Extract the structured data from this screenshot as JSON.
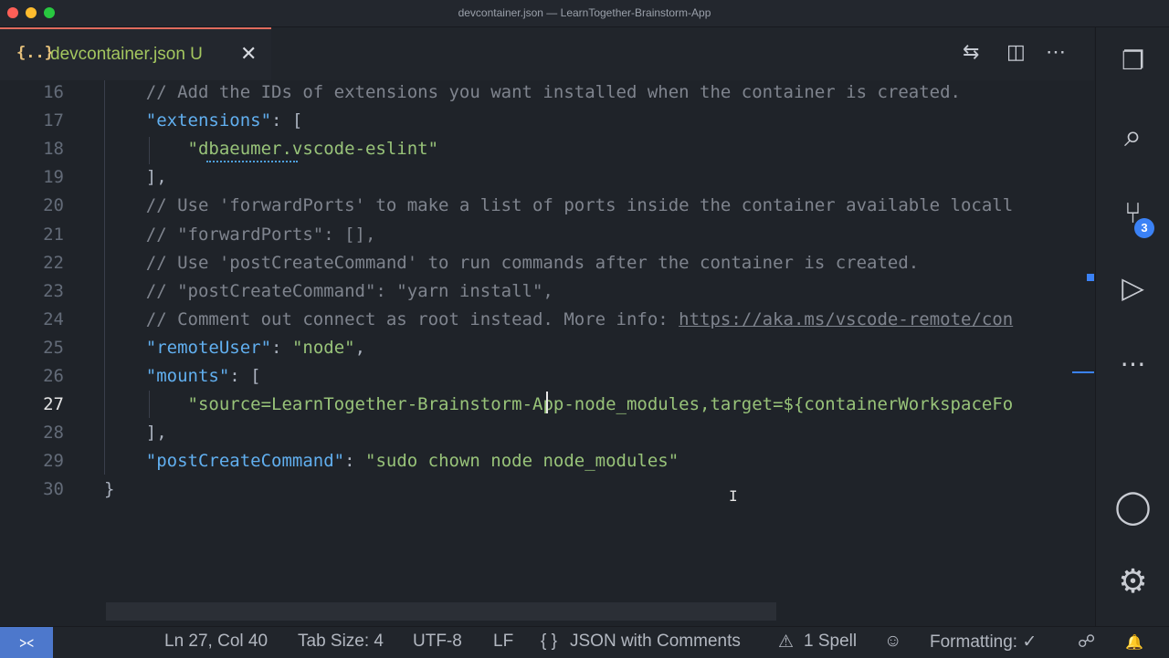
{
  "window": {
    "title": "devcontainer.json — LearnTogether-Brainstorm-App"
  },
  "tab": {
    "icon_text": "{..}",
    "label": "devcontainer.json",
    "status": "U",
    "close": "✕"
  },
  "toolbar": {
    "compare_icon": "⇆",
    "split_icon": "◫",
    "more_icon": "⋯"
  },
  "editor": {
    "active_line": 27,
    "lines": [
      {
        "num": "16"
      },
      {
        "num": "17"
      },
      {
        "num": "18"
      },
      {
        "num": "19"
      },
      {
        "num": "20"
      },
      {
        "num": "21"
      },
      {
        "num": "22"
      },
      {
        "num": "23"
      },
      {
        "num": "24"
      },
      {
        "num": "25"
      },
      {
        "num": "26"
      },
      {
        "num": "27"
      },
      {
        "num": "28"
      },
      {
        "num": "29"
      },
      {
        "num": "30"
      }
    ],
    "tokens": {
      "l16": "    // Add the IDs of extensions you want installed when the container is created.",
      "l17_key": "\"extensions\"",
      "l17_rest": ": [",
      "l18_str": "\"dbaeumer.vscode-eslint\"",
      "l19": "    ],",
      "l20": "    // Use 'forwardPorts' to make a list of ports inside the container available locall",
      "l21": "    // \"forwardPorts\": [],",
      "l22": "    // Use 'postCreateCommand' to run commands after the container is created.",
      "l23": "    // \"postCreateCommand\": \"yarn install\",",
      "l24_cmt": "    // Comment out connect as root instead. More info: ",
      "l24_link": "https://aka.ms/vscode-remote/con",
      "l25_key": "\"remoteUser\"",
      "l25_mid": ": ",
      "l25_str": "\"node\"",
      "l25_end": ",",
      "l26_key": "\"mounts\"",
      "l26_rest": ": [",
      "l27_str": "\"source=LearnTogether-Brainstorm-App-node_modules,target=${containerWorkspaceFo",
      "l28": "    ],",
      "l29_key": "\"postCreateCommand\"",
      "l29_mid": ": ",
      "l29_str": "\"sudo chown node node_modules\"",
      "l30": "}"
    }
  },
  "activity_bar": {
    "items": [
      {
        "name": "explorer-icon",
        "glyph": "❐"
      },
      {
        "name": "search-icon",
        "glyph": "⌕"
      },
      {
        "name": "source-control-icon",
        "glyph": "⑂"
      },
      {
        "name": "run-debug-icon",
        "glyph": "▷"
      },
      {
        "name": "more-icon",
        "glyph": "⋯"
      },
      {
        "name": "account-icon",
        "glyph": "◯"
      },
      {
        "name": "settings-gear-icon",
        "glyph": "⚙"
      }
    ],
    "source_control_badge": "3"
  },
  "status_bar": {
    "remote_icon": "⪥",
    "position": "Ln 27, Col 40",
    "tab_size": "Tab Size: 4",
    "encoding": "UTF-8",
    "eol": "LF",
    "language_icon": "{ }",
    "language": "JSON with Comments",
    "spell_icon": "⚠",
    "spell": "1 Spell",
    "copilot_icon": "☺",
    "formatting": "Formatting: ✓",
    "feedback_icon": "☍",
    "bell_icon": "🔔"
  },
  "colors": {
    "accent": "#4d78cc",
    "tab_border": "#e06c5e",
    "modified_label": "#a4c75f",
    "string": "#98c379",
    "key": "#61afef",
    "comment": "#7f848e"
  }
}
